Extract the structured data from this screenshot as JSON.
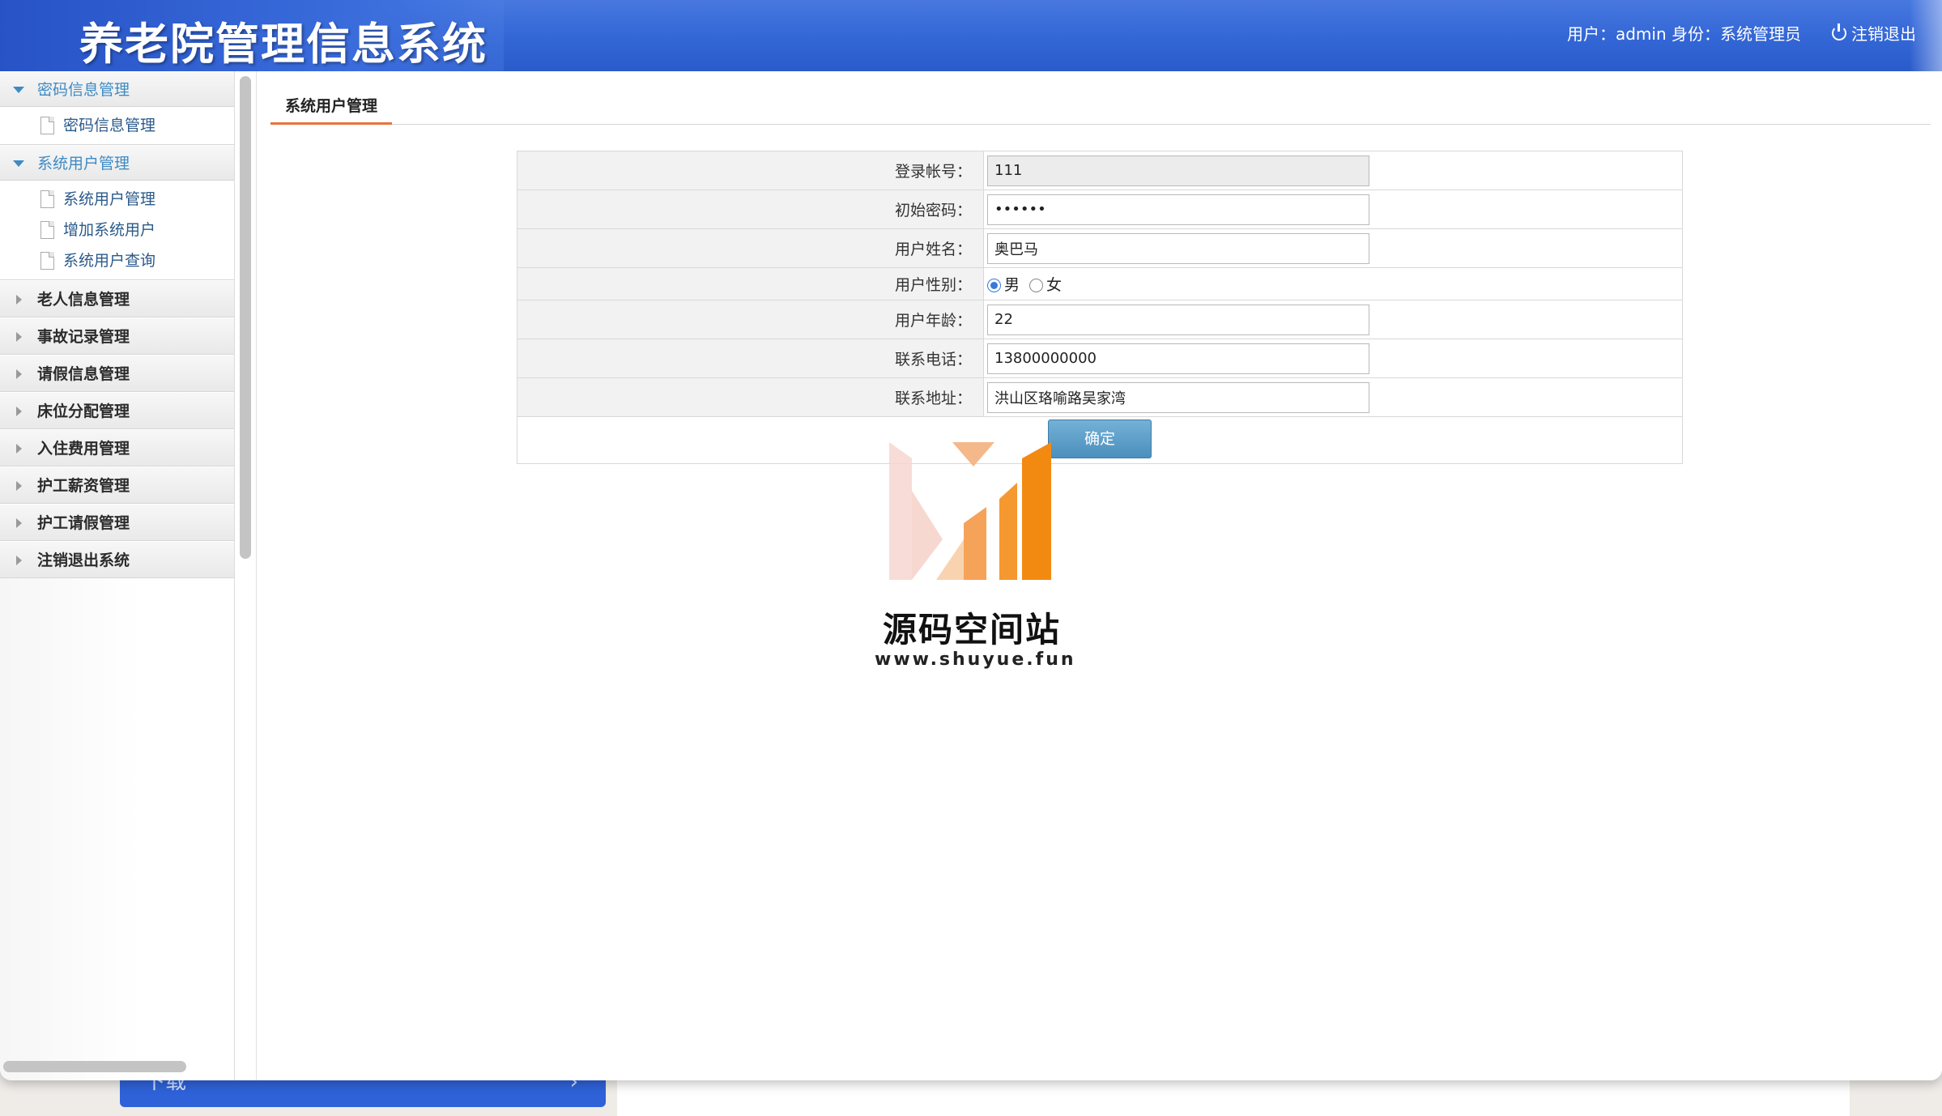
{
  "header": {
    "title": "养老院管理信息系统",
    "userinfo": "用户：admin 身份：系统管理员",
    "logout_label": "注销退出"
  },
  "sidebar": {
    "groups": [
      {
        "label": "密码信息管理",
        "open": true,
        "items": [
          "密码信息管理"
        ]
      },
      {
        "label": "系统用户管理",
        "open": true,
        "items": [
          "系统用户管理",
          "增加系统用户",
          "系统用户查询"
        ]
      },
      {
        "label": "老人信息管理",
        "open": false
      },
      {
        "label": "事故记录管理",
        "open": false
      },
      {
        "label": "请假信息管理",
        "open": false
      },
      {
        "label": "床位分配管理",
        "open": false
      },
      {
        "label": "入住费用管理",
        "open": false
      },
      {
        "label": "护工薪资管理",
        "open": false
      },
      {
        "label": "护工请假管理",
        "open": false
      },
      {
        "label": "注销退出系统",
        "open": false
      }
    ]
  },
  "content": {
    "tab_label": "系统用户管理",
    "form": {
      "account_label": "登录帐号：",
      "account_value": "111",
      "password_label": "初始密码：",
      "password_value": "••••••",
      "name_label": "用户姓名：",
      "name_value": "奥巴马",
      "gender_label": "用户性别：",
      "gender_male": "男",
      "gender_female": "女",
      "gender_selected": "男",
      "age_label": "用户年龄：",
      "age_value": "22",
      "phone_label": "联系电话：",
      "phone_value": "13800000000",
      "address_label": "联系地址：",
      "address_value": "洪山区珞喻路吴家湾",
      "submit_label": "确定"
    }
  },
  "watermark": {
    "name": "源码空间站",
    "url": "www.shuyue.fun"
  },
  "background": {
    "ghost_button_label": "下载",
    "accent": "#3366d6"
  }
}
